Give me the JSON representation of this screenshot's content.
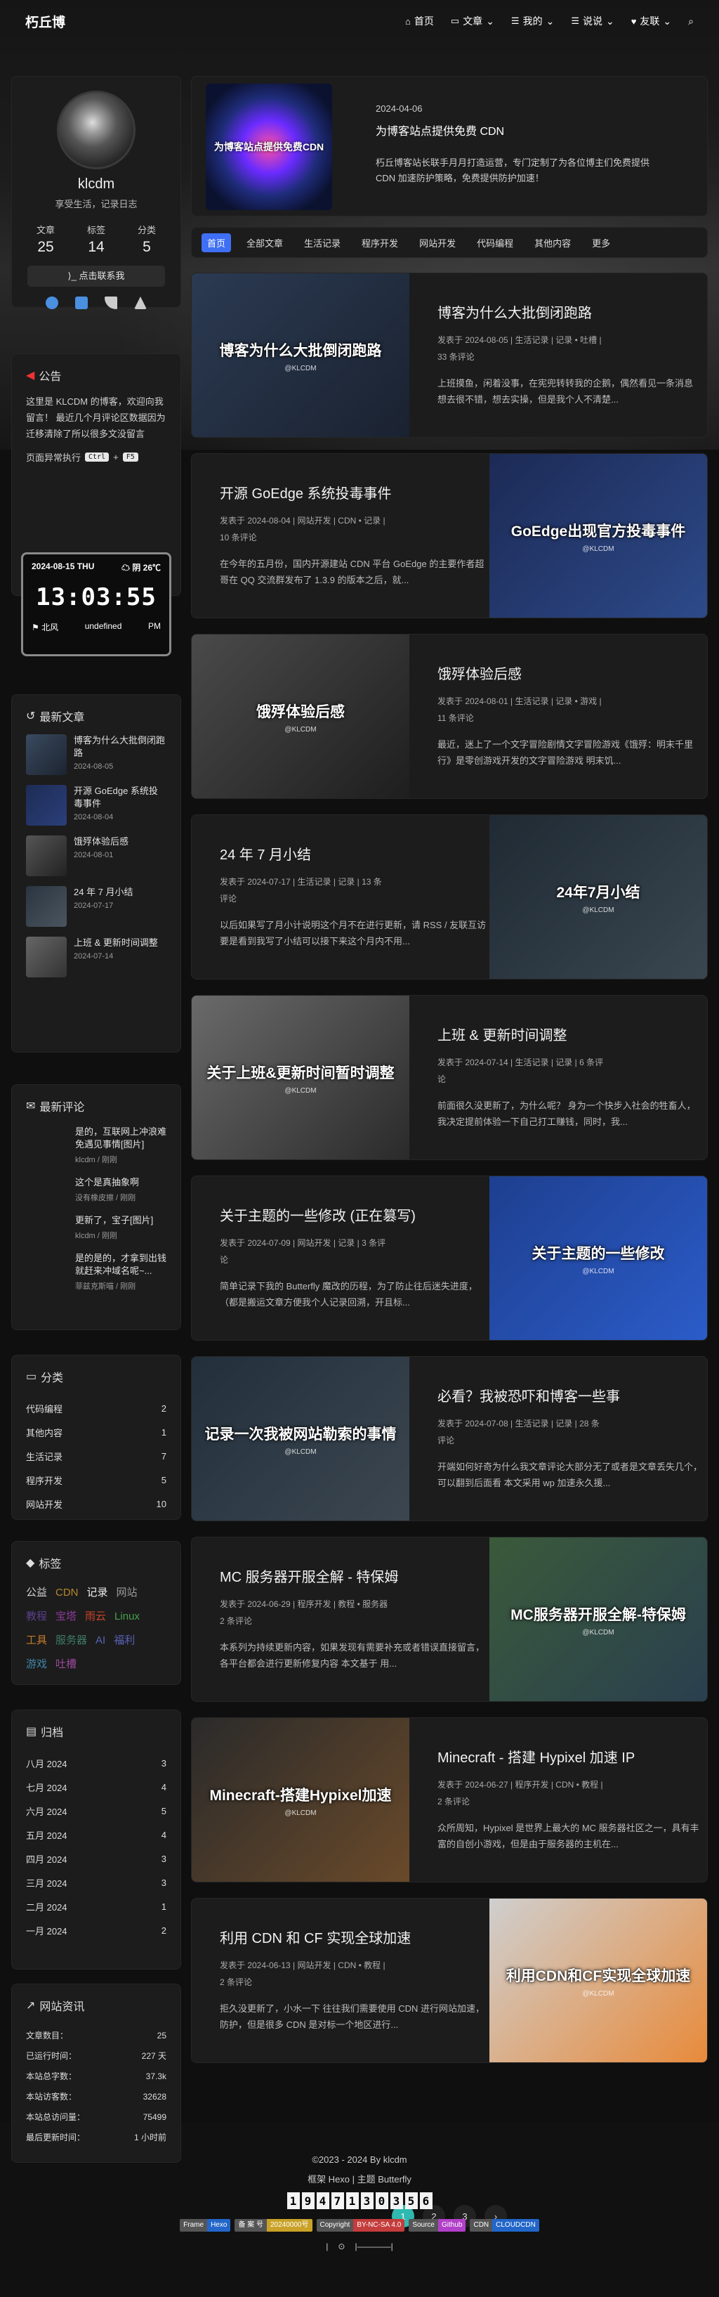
{
  "brand": "朽丘博",
  "nav": [
    {
      "icon": "home-icon",
      "label": "首页"
    },
    {
      "icon": "folder-icon",
      "label": "文章"
    },
    {
      "icon": "list-icon",
      "label": "我的"
    },
    {
      "icon": "list-icon",
      "label": "说说"
    },
    {
      "icon": "heart-icon",
      "label": "友联"
    }
  ],
  "profile": {
    "name": "klcdm",
    "desc": "享受生活，记录日志",
    "stats": [
      {
        "label": "文章",
        "value": "25"
      },
      {
        "label": "标签",
        "value": "14"
      },
      {
        "label": "分类",
        "value": "5"
      }
    ],
    "contact": "点击联系我"
  },
  "announcement": {
    "title": "公告",
    "text": "这里是 KLCDM 的博客，欢迎向我留言！ 最近几个月评论区数据因为迁移清除了所以很多文没留言",
    "extra": "页面异常执行",
    "keys": [
      "Ctrl",
      "F5"
    ]
  },
  "clock": {
    "date": "2024-08-15 THU",
    "weather": "阴 26℃",
    "time": "13:03:55",
    "city": "北风",
    "location": "undefined",
    "ampm": "PM"
  },
  "recent": {
    "title": "最新文章",
    "items": [
      {
        "title": "博客为什么大批倒闭跑路",
        "date": "2024-08-05"
      },
      {
        "title": "开源 GoEdge 系统投毒事件",
        "date": "2024-08-04"
      },
      {
        "title": "饿殍体验后感",
        "date": "2024-08-01"
      },
      {
        "title": "24 年 7 月小结",
        "date": "2024-07-17"
      },
      {
        "title": "上班 & 更新时间调整",
        "date": "2024-07-14"
      }
    ]
  },
  "comments": {
    "title": "最新评论",
    "items": [
      {
        "text": "是的，互联网上冲浪难免遇见事情[图片]",
        "meta": "klcdm / 刚刚"
      },
      {
        "text": "这个是真抽象啊",
        "meta": "没有橡皮擦 / 刚刚"
      },
      {
        "text": "更新了，宝子[图片]",
        "meta": "klcdm / 刚刚"
      },
      {
        "text": "是的是的，才拿到出钱就赶来冲域名呢~...",
        "meta": "菲兹克斯喵 / 刚刚"
      }
    ]
  },
  "categories": {
    "title": "分类",
    "items": [
      {
        "name": "代码编程",
        "count": "2"
      },
      {
        "name": "其他内容",
        "count": "1"
      },
      {
        "name": "生活记录",
        "count": "7"
      },
      {
        "name": "程序开发",
        "count": "5"
      },
      {
        "name": "网站开发",
        "count": "10"
      }
    ]
  },
  "tags": {
    "title": "标签",
    "items": [
      {
        "name": "公益",
        "color": "#cfcfcf"
      },
      {
        "name": "CDN",
        "color": "#b5872f"
      },
      {
        "name": "记录",
        "color": "#f0f0f0"
      },
      {
        "name": "网站",
        "color": "#9a9a9a"
      },
      {
        "name": "教程",
        "color": "#5b3f8f"
      },
      {
        "name": "宝塔",
        "color": "#8a3a9a"
      },
      {
        "name": "雨云",
        "color": "#c8452a"
      },
      {
        "name": "Linux",
        "color": "#45a04a"
      },
      {
        "name": "工具",
        "color": "#c27a2a"
      },
      {
        "name": "服务器",
        "color": "#3f7b6a"
      },
      {
        "name": "AI",
        "color": "#5a62b8"
      },
      {
        "name": "福利",
        "color": "#5a62b8"
      },
      {
        "name": "游戏",
        "color": "#3f87a8"
      },
      {
        "name": "吐槽",
        "color": "#9a4a9a"
      }
    ]
  },
  "archive": {
    "title": "归档",
    "items": [
      {
        "name": "八月 2024",
        "count": "3"
      },
      {
        "name": "七月 2024",
        "count": "4"
      },
      {
        "name": "六月 2024",
        "count": "5"
      },
      {
        "name": "五月 2024",
        "count": "4"
      },
      {
        "name": "四月 2024",
        "count": "3"
      },
      {
        "name": "三月 2024",
        "count": "3"
      },
      {
        "name": "二月 2024",
        "count": "1"
      },
      {
        "name": "一月 2024",
        "count": "2"
      }
    ]
  },
  "siteinfo": {
    "title": "网站资讯",
    "items": [
      {
        "name": "文章数目：",
        "value": "25"
      },
      {
        "name": "已运行时间：",
        "value": "227 天"
      },
      {
        "name": "本站总字数：",
        "value": "37.3k"
      },
      {
        "name": "本站访客数：",
        "value": "32628"
      },
      {
        "name": "本站总访问量：",
        "value": "75499"
      },
      {
        "name": "最后更新时间：",
        "value": "1 小时前"
      }
    ]
  },
  "hero": {
    "image_text": "为博客站点提供免费CDN",
    "date": "2024-04-06",
    "title": "为博客站点提供免费 CDN",
    "excerpt": "朽丘博客站长联手月月打造运营，专门定制了为各位博主们免费提供 CDN 加速防护策略，免费提供防护加速！"
  },
  "tabs": [
    "首页",
    "全部文章",
    "生活记录",
    "程序开发",
    "网站开发",
    "代码编程",
    "其他内容",
    "更多"
  ],
  "posts": [
    {
      "title": "博客为什么大批倒闭跑路",
      "image_text": "博客为什么大批倒闭跑路",
      "watermark": "@KLCDM",
      "meta1": "发表于 2024-08-05 | 生活记录 | 记录 • 吐槽 |",
      "meta2": "33 条评论",
      "excerpt": "上班摸鱼，闲着没事，在宪兜转转我的企鹅，偶然看见一条消息 想去很不错，想去实操，但是我个人不清楚..."
    },
    {
      "title": "开源 GoEdge 系统投毒事件",
      "image_text": "GoEdge出现官方投毒事件",
      "watermark": "@KLCDM",
      "meta1": "发表于 2024-08-04 | 网站开发 | CDN • 记录 |",
      "meta2": "10 条评论",
      "excerpt": "在今年的五月份，国内开源建站 CDN 平台 GoEdge 的主要作者超哥在 QQ 交流群发布了 1.3.9 的版本之后，就..."
    },
    {
      "title": "饿殍体验后感",
      "image_text": "饿殍体验后感",
      "watermark": "@KLCDM",
      "meta1": "发表于 2024-08-01 | 生活记录 | 记录 • 游戏 |",
      "meta2": "11 条评论",
      "excerpt": "最近，迷上了一个文字冒险剧情文字冒险游戏《饿殍：明末千里行》是零创游戏开发的文字冒险游戏 明末饥..."
    },
    {
      "title": "24 年 7 月小结",
      "image_text": "24年7月小结",
      "watermark": "@KLCDM",
      "meta1": "发表于 2024-07-17 | 生活记录 | 记录 | 13 条",
      "meta2": "评论",
      "excerpt": "以后如果写了月小计说明这个月不在进行更新，请 RSS / 友联互访要是看到我写了小结可以接下来这个月内不用..."
    },
    {
      "title": "上班 & 更新时间调整",
      "image_text": "关于上班&更新时间暂时调整",
      "watermark": "@KLCDM",
      "meta1": "发表于 2024-07-14 | 生活记录 | 记录 | 6 条评",
      "meta2": "论",
      "excerpt": "前面很久没更新了，为什么呢？ 身为一个快步入社会的牲畜人，我决定提前体验一下自己打工赚钱，同时，我..."
    },
    {
      "title": "关于主题的一些修改 (正在篡写)",
      "image_text": "关于主题的一些修改",
      "watermark": "@KLCDM",
      "meta1": "发表于 2024-07-09 | 网站开发 | 记录 | 3 条评",
      "meta2": "论",
      "excerpt": "简单记录下我的 Butterfly 魔改的历程，为了防止往后迷失进度，（都是搬运文章方便我个人记录回溯，开且标..."
    },
    {
      "title": "必看？我被恐吓和博客一些事",
      "image_text": "记录一次我被网站勒索的事情",
      "watermark": "@KLCDM",
      "meta1": "发表于 2024-07-08 | 生活记录 | 记录 | 28 条",
      "meta2": "评论",
      "excerpt": "开端如何好奇为什么我文章评论大部分无了或者是文章丢失几个，可以翻到后面看 本文采用 wp 加速永久援..."
    },
    {
      "title": "MC 服务器开服全解 - 特保姆",
      "image_text": "MC服务器开服全解-特保姆",
      "watermark": "@KLCDM",
      "meta1": "发表于 2024-06-29 | 程序开发 | 教程 • 服务器",
      "meta2": "2 条评论",
      "excerpt": "本系列为持续更新内容，如果发现有需要补充或者错误直接留言，各平台都会进行更新修复内容 本文基于 用..."
    },
    {
      "title": "Minecraft - 搭建 Hypixel 加速 IP",
      "image_text": "Minecraft-搭建Hypixel加速",
      "watermark": "@KLCDM",
      "meta1": "发表于 2024-06-27 | 程序开发 | CDN • 教程 |",
      "meta2": "2 条评论",
      "excerpt": "众所周知，Hypixel 是世界上最大的 MC 服务器社区之一，具有丰富的自创小游戏，但是由于服务器的主机在..."
    },
    {
      "title": "利用 CDN 和 CF 实现全球加速",
      "image_text": "利用CDN和CF实现全球加速",
      "watermark": "@KLCDM",
      "meta1": "发表于 2024-06-13 | 网站开发 | CDN • 教程 |",
      "meta2": "2 条评论",
      "excerpt": "拒久没更新了，小水一下 往往我们需要使用 CDN 进行网站加速，防护，但是很多 CDN 是对标一个地区进行..."
    }
  ],
  "pager": [
    "1",
    "2",
    "3",
    "›"
  ],
  "footer": {
    "copyright": "©2023 - 2024 By klcdm",
    "framework": "框架 Hexo | 主题 Butterfly",
    "counter": [
      "1",
      "9",
      "4",
      "7",
      "1",
      "3",
      "0",
      "3",
      "5",
      "6"
    ],
    "badges": [
      {
        "a": "Frame",
        "b": "Hexo",
        "color": "#2266c9"
      },
      {
        "a": "备 案 号",
        "b": "20240000号",
        "color": "#c9a227"
      },
      {
        "a": "Copyright",
        "b": "BY-NC-SA 4.0",
        "color": "#c43c3c"
      },
      {
        "a": "Source",
        "b": "Github",
        "color": "#b23fc9"
      },
      {
        "a": "CDN",
        "b": "CLOUDCDN",
        "color": "#2266c9"
      }
    ],
    "mini": [
      "|",
      "⊙",
      "|————|"
    ]
  }
}
